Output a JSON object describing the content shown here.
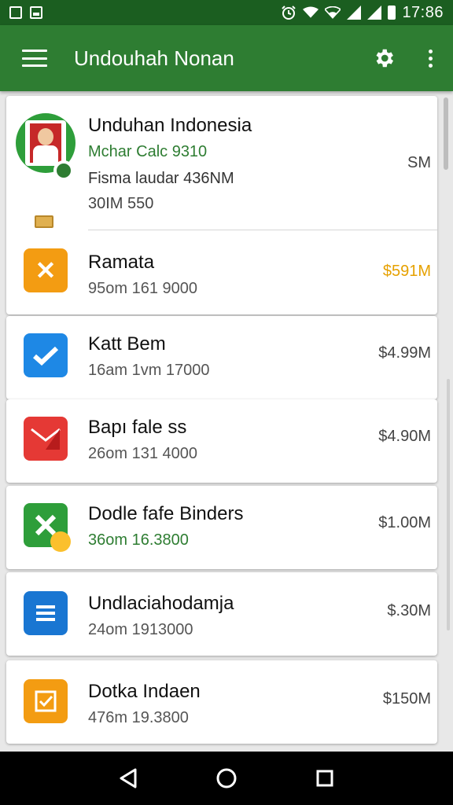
{
  "status_bar": {
    "time": "17:86",
    "icons": [
      "image-icon",
      "gallery-icon",
      "alarm-icon",
      "wifi-icon",
      "wifi-alt-icon",
      "signal-icon",
      "signal-icon-2",
      "battery-icon"
    ]
  },
  "app_bar": {
    "title": "Undouhah Nonan",
    "menu_icon": "hamburger-menu-icon",
    "settings_icon": "gear-icon",
    "overflow_icon": "more-vert-icon",
    "color": "#2e7d32"
  },
  "items": [
    {
      "title": "Unduhan Indonesia",
      "line1": "Mchar Calc 9310",
      "line2": "Fisma laudar 436NM",
      "line3": "30IM 550",
      "size": "SM",
      "icon": "avatar-photo-icon",
      "line1_color": "#2e7d32"
    },
    {
      "title": "Ramata",
      "sub": "95om 161 9000",
      "size": "$591M",
      "icon": "orange-x-app-icon",
      "size_color": "#e6a100"
    },
    {
      "title": "Katt Bem",
      "sub": "16am 1vm 17000",
      "size": "$4.99M",
      "icon": "blue-check-app-icon"
    },
    {
      "title": "Bapı fale ss",
      "sub": "26om 131 4000",
      "size": "$4.90M",
      "icon": "red-mail-app-icon"
    },
    {
      "title": "Dodle fafe Binders",
      "sub": "36om 16.3800",
      "size": "$1.00M",
      "icon": "green-sheet-app-icon",
      "sub_color": "#2e7d32"
    },
    {
      "title": "Undlaciahodamja",
      "sub": "24om 1913000",
      "size": "$.30M",
      "icon": "blue-doc-app-icon"
    },
    {
      "title": "Dotka Indaen",
      "sub": "476m 19.3800",
      "size": "$150M",
      "icon": "orange-check-app-icon"
    }
  ],
  "nav_bar": {
    "back_icon": "back-triangle-icon",
    "home_icon": "home-circle-icon",
    "recents_icon": "recents-square-icon"
  }
}
